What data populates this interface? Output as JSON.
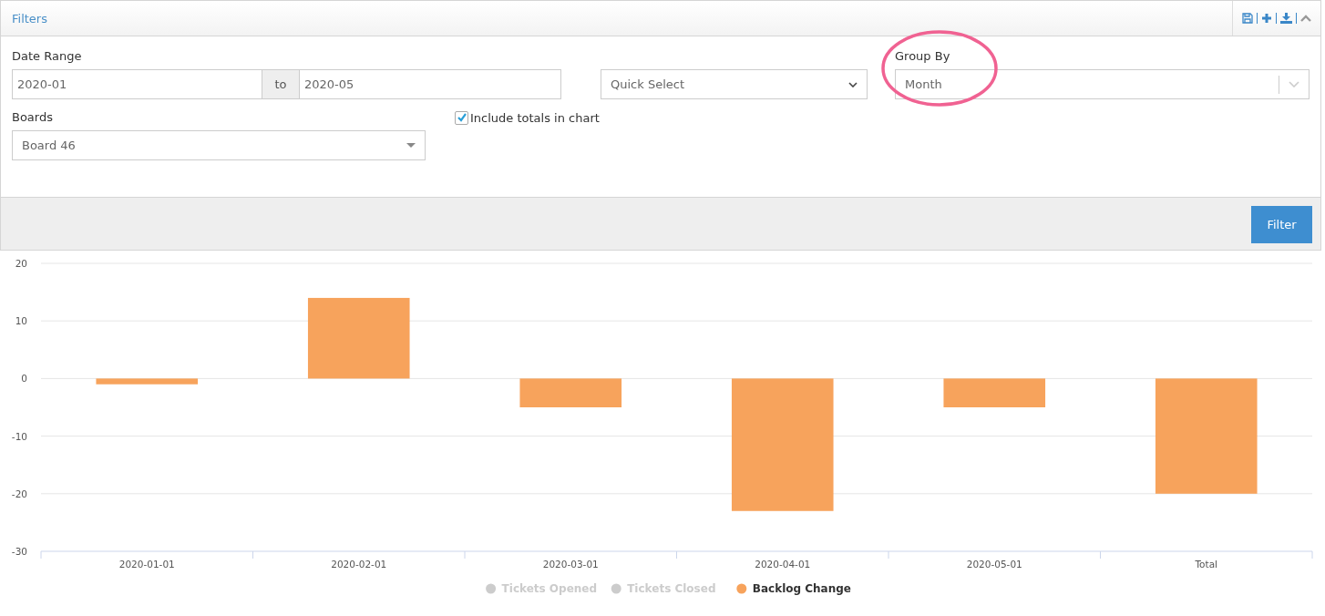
{
  "panel": {
    "title": "Filters",
    "tools": [
      {
        "kind": "save"
      },
      {
        "kind": "add"
      },
      {
        "kind": "download"
      },
      {
        "kind": "collapse"
      }
    ]
  },
  "filters": {
    "date_range": {
      "label": "Date Range",
      "from": "2020-01",
      "separator": "to",
      "to": "2020-05"
    },
    "quick_select": {
      "value": "Quick Select"
    },
    "group_by": {
      "label": "Group By",
      "value": "Month",
      "highlighted": true
    },
    "boards": {
      "label": "Boards",
      "value": "Board 46"
    },
    "include_totals": {
      "label": "Include totals in chart",
      "checked": true
    }
  },
  "filter_button": "Filter",
  "chart": {
    "chart_data": {
      "type": "bar",
      "categories": [
        "2020-01-01",
        "2020-02-01",
        "2020-03-01",
        "2020-04-01",
        "2020-05-01",
        "Total"
      ],
      "series": [
        {
          "name": "Tickets Opened",
          "color": "#cccccc",
          "values": [
            null,
            null,
            null,
            null,
            null,
            null
          ]
        },
        {
          "name": "Tickets Closed",
          "color": "#cccccc",
          "values": [
            null,
            null,
            null,
            null,
            null,
            null
          ]
        },
        {
          "name": "Backlog Change",
          "color": "#f7a35c",
          "values": [
            -1,
            14,
            -5,
            -23,
            -5,
            -20
          ]
        }
      ],
      "ylim": [
        -30,
        20
      ],
      "yticks": [
        -30,
        -20,
        -10,
        0,
        10,
        20
      ],
      "grid": true
    },
    "legend": [
      {
        "visible": false
      },
      {
        "visible": false
      },
      {
        "visible": true
      }
    ]
  }
}
